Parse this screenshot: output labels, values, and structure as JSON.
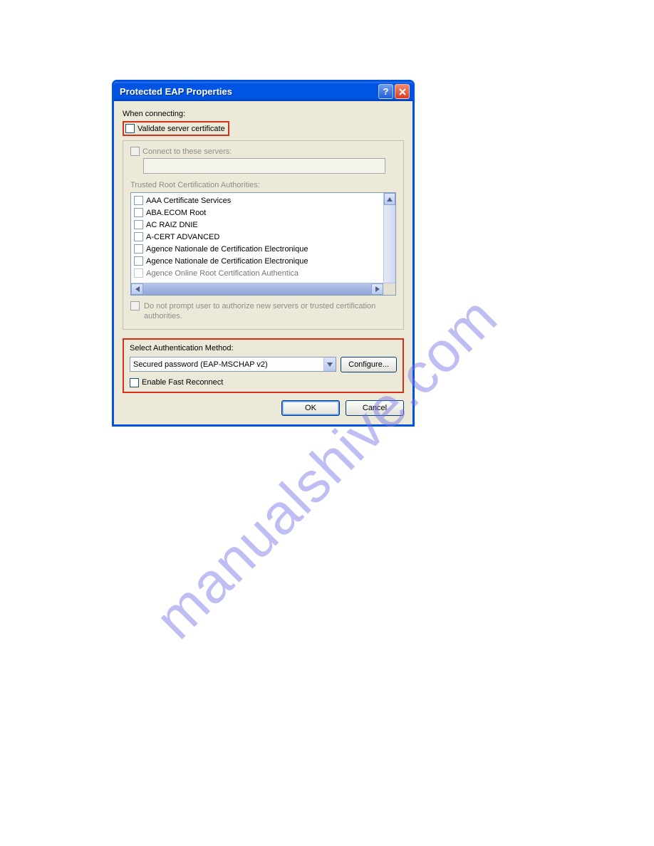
{
  "window": {
    "title": "Protected EAP Properties"
  },
  "labels": {
    "when_connecting": "When connecting:",
    "validate_cert": "Validate server certificate",
    "connect_servers": "Connect to these servers:",
    "trusted_root": "Trusted Root Certification Authorities:",
    "no_prompt": "Do not prompt user to authorize new servers or trusted certification authorities.",
    "select_auth": "Select Authentication Method:",
    "auth_value": "Secured password (EAP-MSCHAP v2)",
    "configure": "Configure...",
    "fast_reconnect": "Enable Fast Reconnect",
    "ok": "OK",
    "cancel": "Cancel"
  },
  "cert_authorities": [
    "AAA Certificate Services",
    "ABA.ECOM Root",
    "AC RAIZ DNIE",
    "A-CERT ADVANCED",
    "Agence Nationale de Certification Electronique",
    "Agence Nationale de Certification Electronique",
    "Agence Online Root Certification Authentica"
  ],
  "watermark": "manualshive.com"
}
